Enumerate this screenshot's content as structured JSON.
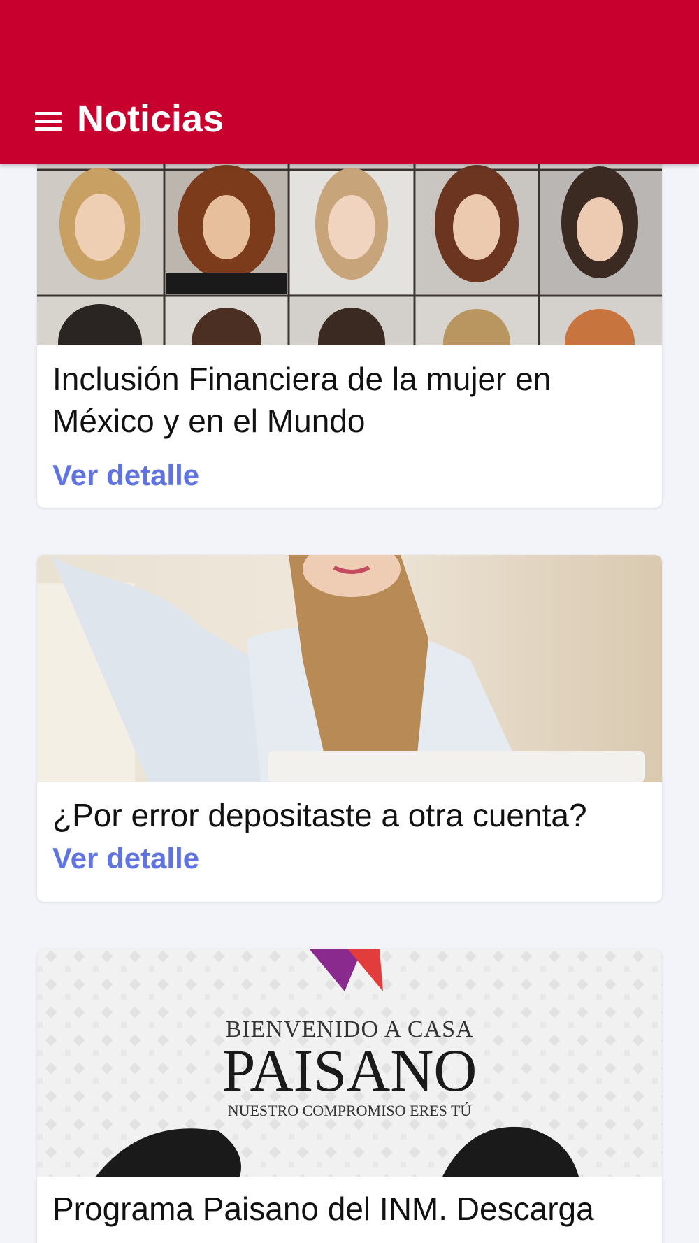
{
  "header": {
    "title": "Noticias",
    "menu_icon": "hamburger-menu-icon",
    "background": "#c8002d"
  },
  "accent_link_color": "#5f73e3",
  "news": [
    {
      "title": "Inclusión Financiera de la mujer en México y en el Mundo",
      "link_label": "Ver detalle",
      "image": "grid of smiling women portraits"
    },
    {
      "title": "¿Por error depositaste a otra cuenta?",
      "link_label": "Ver detalle",
      "image": "woman at laptop"
    },
    {
      "title": "Programa Paisano del INM. Descarga",
      "link_label": "",
      "image": "Programa Paisano poster",
      "image_text": {
        "line1": "BIENVENIDO A CASA",
        "line2": "PAISANO",
        "line3": "NUESTRO COMPROMISO ERES TÚ"
      }
    }
  ]
}
